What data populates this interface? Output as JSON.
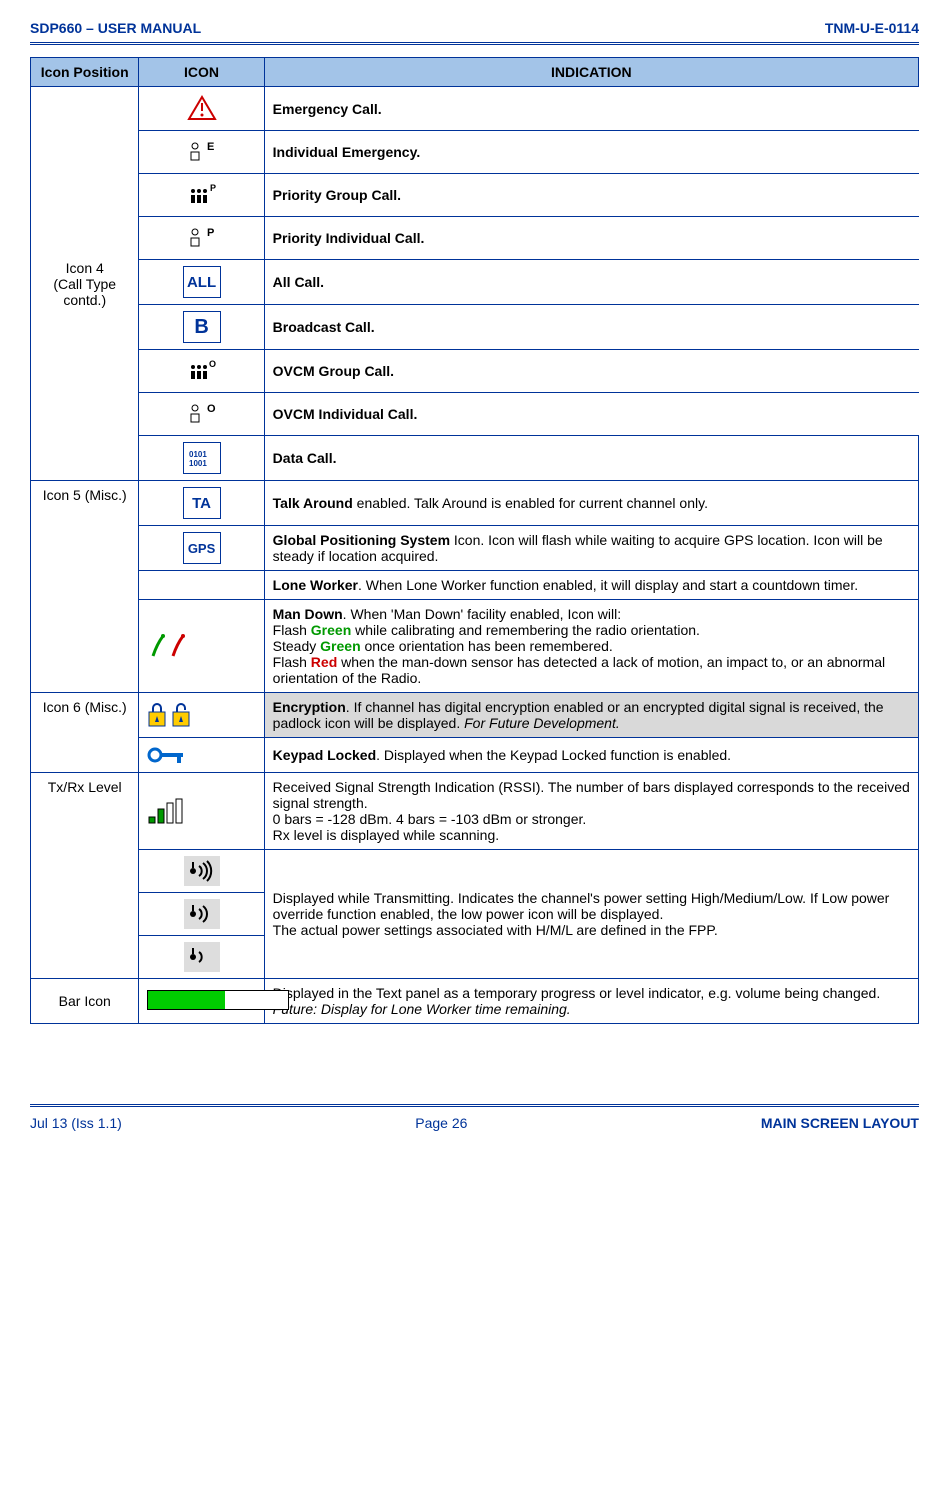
{
  "header": {
    "left": "SDP660 – USER MANUAL",
    "right": "TNM-U-E-0114"
  },
  "table": {
    "headers": {
      "pos": "Icon Position",
      "icon": "ICON",
      "indication": "INDICATION"
    },
    "group4": {
      "label": "Icon 4\n(Call Type contd.)",
      "rows": [
        {
          "ind": "Emergency Call."
        },
        {
          "ind": "Individual Emergency."
        },
        {
          "ind": "Priority Group Call."
        },
        {
          "ind": "Priority Individual Call."
        },
        {
          "ind": "All Call."
        },
        {
          "ind": "Broadcast Call."
        },
        {
          "ind": "OVCM Group Call."
        },
        {
          "ind": "OVCM Individual Call."
        },
        {
          "ind": "Data Call."
        }
      ]
    },
    "group5": {
      "label": "Icon 5 (Misc.)",
      "rows": {
        "ta": {
          "lead": "Talk Around",
          "rest": " enabled.  Talk Around is enabled for current channel only."
        },
        "gps": {
          "lead": "Global Positioning System",
          "rest": " Icon.  Icon will flash while waiting to acquire GPS location.  Icon will be steady if location acquired."
        },
        "lw": {
          "lead": "Lone Worker",
          "rest": ".  When Lone Worker function enabled, it will display and start a countdown timer."
        },
        "md": {
          "lead": "Man Down",
          "l1": ".  When 'Man Down' facility enabled, Icon will:",
          "l2a": "Flash ",
          "l2b": "Green",
          "l2c": " while calibrating and remembering the radio orientation.",
          "l3a": "Steady ",
          "l3b": "Green",
          "l3c": " once orientation has been remembered.",
          "l4a": "Flash ",
          "l4b": "Red",
          "l4c": " when the man-down sensor has detected a lack of motion, an impact to, or an abnormal orientation of the Radio."
        }
      }
    },
    "group6": {
      "label": "Icon 6 (Misc.)",
      "enc": {
        "lead": "Encryption",
        "rest": ".  If channel has digital encryption enabled or an encrypted digital signal is received, the padlock icon will be displayed.  ",
        "italic": "For Future Development."
      },
      "key": {
        "lead": "Keypad Locked",
        "rest": ".  Displayed when the Keypad Locked function is enabled."
      }
    },
    "txrx": {
      "label": "Tx/Rx Level",
      "rssi": "Received Signal Strength Indication (RSSI).  The number of bars displayed corresponds to the received signal strength.\n0 bars = -128 dBm.  4 bars = -103 dBm or stronger.\nRx level is displayed while scanning.",
      "tx": "Displayed while Transmitting.  Indicates the channel's power setting High/Medium/Low.  If Low power override function enabled, the low power icon will be displayed.\nThe actual power settings associated with H/M/L are defined in the FPP."
    },
    "bar": {
      "label": "Bar Icon",
      "text": "Displayed in the Text panel as a temporary progress or level indicator, e.g. volume being changed.",
      "italic": "Future: Display for Lone Worker time remaining."
    }
  },
  "footer": {
    "left": "Jul 13 (Iss 1.1)",
    "center": "Page 26",
    "right": "MAIN SCREEN LAYOUT"
  },
  "icons": {
    "all": "ALL",
    "b": "B",
    "ta": "TA",
    "gps": "GPS"
  }
}
